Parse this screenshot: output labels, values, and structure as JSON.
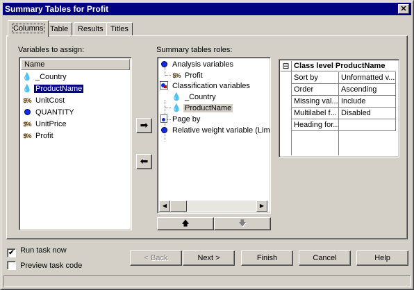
{
  "window": {
    "title": "Summary Tables for Profit",
    "close_glyph": "✕"
  },
  "tabs": [
    {
      "label": "Columns",
      "active": true
    },
    {
      "label": "Table"
    },
    {
      "label": "Results"
    },
    {
      "label": "Titles"
    }
  ],
  "variables": {
    "label": "Variables to assign:",
    "column_header": "Name",
    "items": [
      {
        "name": "_Country",
        "icon": "character-variable-icon"
      },
      {
        "name": "ProductName",
        "icon": "character-variable-icon",
        "selected": true
      },
      {
        "name": "UnitCost",
        "icon": "currency-variable-icon"
      },
      {
        "name": "QUANTITY",
        "icon": "numeric-variable-icon"
      },
      {
        "name": "UnitPrice",
        "icon": "currency-variable-icon"
      },
      {
        "name": "Profit",
        "icon": "currency-variable-icon"
      }
    ]
  },
  "arrows": {
    "assign": "➡",
    "remove": "⬅"
  },
  "roles": {
    "label": "Summary tables roles:",
    "tree": [
      {
        "label": "Analysis variables",
        "icon": "numeric-role-icon",
        "level": 0
      },
      {
        "label": "Profit",
        "icon": "currency-variable-icon",
        "level": 1
      },
      {
        "label": "Classification variables",
        "icon": "class-role-icon",
        "level": 0
      },
      {
        "label": "_Country",
        "icon": "character-variable-icon",
        "level": 1
      },
      {
        "label": "ProductName",
        "icon": "character-variable-icon",
        "level": 1,
        "highlighted": true
      },
      {
        "label": "Page by",
        "icon": "page-role-icon",
        "level": 0
      },
      {
        "label": "Relative weight variable  (Lim",
        "icon": "numeric-role-icon",
        "level": 0
      }
    ],
    "move_up": "🡅",
    "move_down": "🡇"
  },
  "properties": {
    "collapse_glyph": "⊟",
    "title": "Class level ProductName",
    "rows": [
      {
        "key": "Sort by",
        "value": "Unformatted v..."
      },
      {
        "key": "Order",
        "value": "Ascending"
      },
      {
        "key": "Missing val...",
        "value": "Include"
      },
      {
        "key": "Multilabel f...",
        "value": "Disabled"
      },
      {
        "key": "Heading for...",
        "value": ""
      }
    ]
  },
  "options": {
    "run_task_now": {
      "label": "Run task now",
      "checked": true,
      "mark": "✔"
    },
    "preview_task_code": {
      "label": "Preview task code",
      "checked": false,
      "mark": ""
    }
  },
  "buttons": {
    "back": "< Back",
    "next": "Next >",
    "finish": "Finish",
    "cancel": "Cancel",
    "help": "Help"
  }
}
